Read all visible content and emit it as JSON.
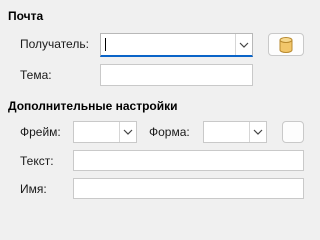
{
  "mail": {
    "title": "Почта",
    "recipient_label": "Получатель:",
    "recipient_value": "",
    "subject_label": "Тема:",
    "subject_value": "",
    "database_icon": "database-icon"
  },
  "advanced": {
    "title": "Дополнительные настройки",
    "frame_label": "Фрейм:",
    "frame_value": "",
    "form_label": "Форма:",
    "form_value": "",
    "text_label": "Текст:",
    "text_value": "",
    "name_label": "Имя:",
    "name_value": ""
  },
  "colors": {
    "focus_accent": "#0a64c8",
    "database_icon_fill": "#f2c66a"
  }
}
